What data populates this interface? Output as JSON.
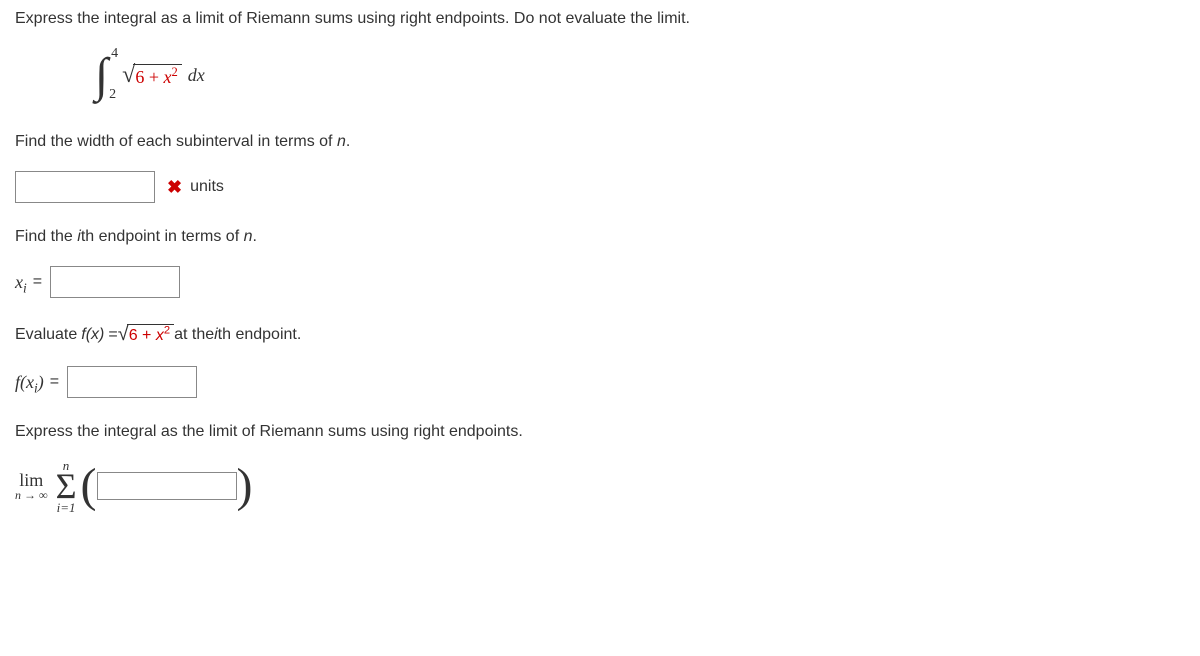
{
  "title": "Express the integral as a limit of Riemann sums using right endpoints. Do not evaluate the limit.",
  "integral": {
    "upper": "4",
    "lower": "2",
    "radicand_pre": "6 + ",
    "radicand_var": "x",
    "dx": "dx"
  },
  "q1": {
    "prompt_pre": "Find the width of each subinterval in terms of ",
    "var": "n",
    "units": "units"
  },
  "q2": {
    "prompt_pre": "Find the ",
    "ith": "i",
    "prompt_mid": "th endpoint in terms of ",
    "var": "n",
    "label_var": "x",
    "label_sub": "i",
    "equals": " ="
  },
  "q3": {
    "prompt_pre": "Evaluate ",
    "fx": "f(x)",
    "eq": " = ",
    "radicand_pre": "6 + ",
    "radicand_var": "x",
    "prompt_post_pre": " at the ",
    "ith": "i",
    "prompt_post": "th endpoint.",
    "label_f": "f",
    "label_x": "x",
    "label_i": "i",
    "equals": " ="
  },
  "q4": {
    "prompt": "Express the integral as the limit of Riemann sums using right endpoints.",
    "lim": "lim",
    "lim_sub_var": "n",
    "lim_sub_arrow": " → ∞",
    "sum_upper": "n",
    "sigma": "Σ",
    "sum_lower_var": "i",
    "sum_lower_rest": "=1"
  }
}
